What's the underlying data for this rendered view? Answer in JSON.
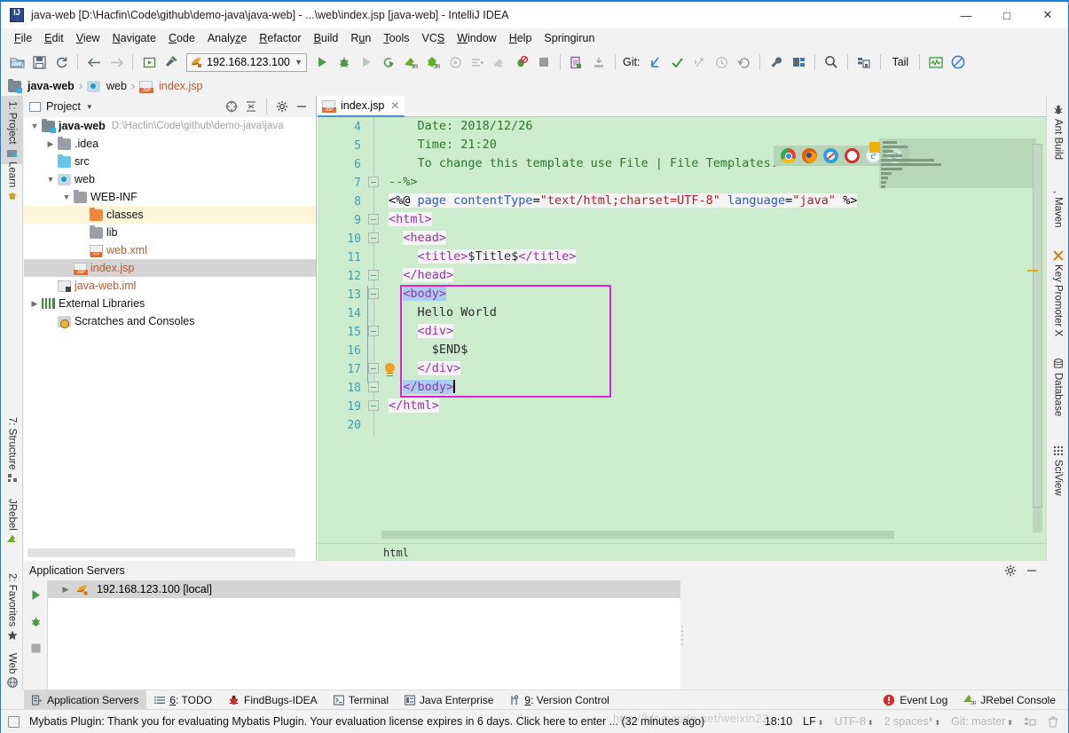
{
  "window": {
    "title": "java-web [D:\\Hacfin\\Code\\github\\demo-java\\java-web] - ...\\web\\index.jsp [java-web] - IntelliJ IDEA",
    "minimize": "—",
    "maximize": "□",
    "close": "✕"
  },
  "menu": {
    "items": [
      {
        "label": "File"
      },
      {
        "label": "Edit"
      },
      {
        "label": "View"
      },
      {
        "label": "Navigate"
      },
      {
        "label": "Code"
      },
      {
        "label": "Analyze"
      },
      {
        "label": "Refactor"
      },
      {
        "label": "Build"
      },
      {
        "label": "Run"
      },
      {
        "label": "Tools"
      },
      {
        "label": "VCS"
      },
      {
        "label": "Window"
      },
      {
        "label": "Help"
      },
      {
        "label": "Springirun"
      }
    ]
  },
  "toolbar": {
    "run_config": "192.168.123.100",
    "git_label": "Git:",
    "tail_label": "Tail"
  },
  "breadcrumb": {
    "project": "java-web",
    "folder": "web",
    "file": "index.jsp",
    "separator": "›"
  },
  "left_bar": {
    "tabs": [
      {
        "label": "1: Project",
        "active": true
      },
      {
        "label": "Learn",
        "active": false
      },
      {
        "label": "7: Structure",
        "active": false
      },
      {
        "label": "JRebel",
        "active": false
      },
      {
        "label": "2: Favorites",
        "active": false
      },
      {
        "label": "Web",
        "active": false
      }
    ]
  },
  "right_bar": {
    "tabs": [
      {
        "label": "Ant Build"
      },
      {
        "label": "Maven"
      },
      {
        "label": "Key Promoter X"
      },
      {
        "label": "Database"
      },
      {
        "label": "SciView"
      }
    ]
  },
  "project_panel": {
    "title": "Project",
    "tree": [
      {
        "label": "java-web",
        "path": "D:\\Hacfin\\Code\\github\\demo-java\\java",
        "indent": 0,
        "arrow": "expanded",
        "icon": "module-folder",
        "bold": true,
        "state": "normal"
      },
      {
        "label": ".idea",
        "path": "",
        "indent": 1,
        "arrow": "collapsed",
        "icon": "folder",
        "bold": false,
        "state": "normal"
      },
      {
        "label": "src",
        "path": "",
        "indent": 1,
        "arrow": "none",
        "icon": "source-folder",
        "bold": false,
        "state": "normal"
      },
      {
        "label": "web",
        "path": "",
        "indent": 1,
        "arrow": "expanded",
        "icon": "web-folder",
        "bold": false,
        "state": "normal"
      },
      {
        "label": "WEB-INF",
        "path": "",
        "indent": 2,
        "arrow": "expanded",
        "icon": "folder",
        "bold": false,
        "state": "normal"
      },
      {
        "label": "classes",
        "path": "",
        "indent": 3,
        "arrow": "none",
        "icon": "excluded-folder",
        "bold": false,
        "state": "highlight"
      },
      {
        "label": "lib",
        "path": "",
        "indent": 3,
        "arrow": "none",
        "icon": "folder",
        "bold": false,
        "state": "normal"
      },
      {
        "label": "web.xml",
        "path": "",
        "indent": 3,
        "arrow": "none",
        "icon": "xml-file",
        "bold": false,
        "state": "normal"
      },
      {
        "label": "index.jsp",
        "path": "",
        "indent": 2,
        "arrow": "none",
        "icon": "jsp-file",
        "bold": false,
        "state": "selected"
      },
      {
        "label": "java-web.iml",
        "path": "",
        "indent": 1,
        "arrow": "none",
        "icon": "iml-file",
        "bold": false,
        "state": "normal"
      },
      {
        "label": "External Libraries",
        "path": "",
        "indent": 0,
        "arrow": "collapsed",
        "icon": "library",
        "bold": false,
        "state": "normal"
      },
      {
        "label": "Scratches and Consoles",
        "path": "",
        "indent": 0,
        "arrow": "none",
        "icon": "scratches",
        "bold": false,
        "state": "normal"
      }
    ]
  },
  "editor": {
    "tab_label": "index.jsp",
    "tab_close": "✕",
    "breadcrumb": "html",
    "lines": [
      {
        "num": 4,
        "text": "    Date: 2018/12/26"
      },
      {
        "num": 5,
        "text": "    Time: 21:20"
      },
      {
        "num": 6,
        "text": "    To change this template use File | File Templates."
      },
      {
        "num": 7,
        "text": "--%>"
      },
      {
        "num": 8,
        "text": "<%@ page contentType=\"text/html;charset=UTF-8\" language=\"java\" %>"
      },
      {
        "num": 9,
        "text": "<html>"
      },
      {
        "num": 10,
        "text": "  <head>"
      },
      {
        "num": 11,
        "text": "    <title>$Title$</title>"
      },
      {
        "num": 12,
        "text": "  </head>"
      },
      {
        "num": 13,
        "text": "  <body>"
      },
      {
        "num": 14,
        "text": "    Hello World"
      },
      {
        "num": 15,
        "text": "    <div>"
      },
      {
        "num": 16,
        "text": "      $END$"
      },
      {
        "num": 17,
        "text": "    </div>"
      },
      {
        "num": 18,
        "text": "  </body>"
      },
      {
        "num": 19,
        "text": "</html>"
      },
      {
        "num": 20,
        "text": ""
      }
    ],
    "browser_popup": [
      "chrome-icon",
      "firefox-icon",
      "safari-icon",
      "opera-icon",
      "ie-icon",
      "edge-icon"
    ]
  },
  "bottom_panel": {
    "title": "Application Servers",
    "server": "192.168.123.100 [local]"
  },
  "tool_tabs": {
    "items": [
      {
        "label": "Application Servers",
        "icon": "app-servers-icon",
        "active": true
      },
      {
        "label": "6: TODO",
        "icon": "todo-icon",
        "active": false
      },
      {
        "label": "FindBugs-IDEA",
        "icon": "findbugs-icon",
        "active": false
      },
      {
        "label": "Terminal",
        "icon": "terminal-icon",
        "active": false
      },
      {
        "label": "Java Enterprise",
        "icon": "java-enterprise-icon",
        "active": false
      },
      {
        "label": "9: Version Control",
        "icon": "version-control-icon",
        "active": false
      }
    ],
    "right": [
      {
        "label": "Event Log",
        "icon": "event-log-icon"
      },
      {
        "label": "JRebel Console",
        "icon": "jrebel-icon"
      }
    ]
  },
  "status_bar": {
    "message": "Mybatis Plugin: Thank you for evaluating Mybatis Plugin. Your evaluation license expires in 6 days.  Click here to enter ... (32 minutes ago)",
    "time": "18:10",
    "line_sep": "LF",
    "encoding": "UTF-8",
    "indent": "2 spaces*",
    "branch": "Git: master",
    "watermark": "http://blog.csdn.net/weixin22"
  },
  "colors": {
    "editor_bg": "#cdebcd",
    "annotation": "#e020e0",
    "accent": "#4a90d9",
    "tag": "#9b2fae",
    "string": "#b02020",
    "comment": "#2a7a2a"
  }
}
